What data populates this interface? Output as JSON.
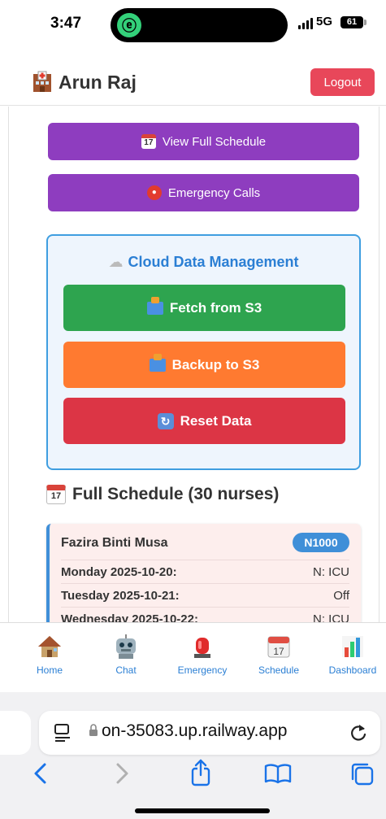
{
  "status": {
    "time": "3:47",
    "network": "5G",
    "battery": "61"
  },
  "header": {
    "user_name": "Arun Raj",
    "logout_label": "Logout"
  },
  "quick_actions": {
    "view_schedule_label": "View Full Schedule",
    "emergency_calls_label": "Emergency Calls",
    "calendar_glyph": "17"
  },
  "cloud": {
    "title": "Cloud Data Management",
    "fetch_label": "Fetch from S3",
    "backup_label": "Backup to S3",
    "reset_label": "Reset Data"
  },
  "schedule": {
    "title": "Full Schedule (30 nurses)",
    "nurse": {
      "name": "Fazira Binti Musa",
      "id": "N1000",
      "rows": [
        {
          "day": "Monday 2025-10-20:",
          "shift": "N: ICU"
        },
        {
          "day": "Tuesday 2025-10-21:",
          "shift": "Off"
        },
        {
          "day": "Wednesday 2025-10-22:",
          "shift": "N: ICU"
        }
      ]
    }
  },
  "tabs": [
    {
      "label": "Home",
      "icon": "home-icon"
    },
    {
      "label": "Chat",
      "icon": "robot-icon"
    },
    {
      "label": "Emergency",
      "icon": "siren-icon"
    },
    {
      "label": "Schedule",
      "icon": "calendar-icon"
    },
    {
      "label": "Dashboard",
      "icon": "bar-chart-icon"
    }
  ],
  "browser": {
    "url": "on-35083.up.railway.app"
  },
  "colors": {
    "purple": "#8e3dbf",
    "accent_blue": "#2b7fd4",
    "fetch_green": "#2ea44f",
    "backup_orange": "#ff7a30",
    "reset_red": "#dc3545",
    "logout_red": "#e8475a"
  }
}
